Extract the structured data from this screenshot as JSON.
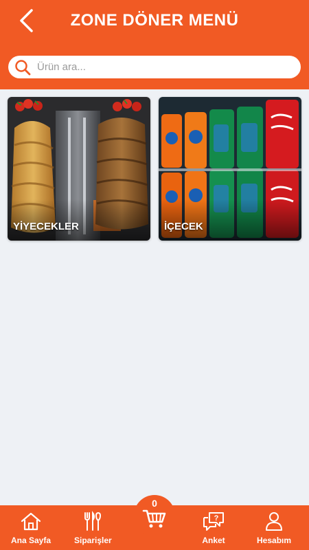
{
  "header": {
    "title": "ZONE DÖNER MENÜ",
    "back_icon": "chevron-left-icon",
    "bg_color": "#f15a24"
  },
  "search": {
    "placeholder": "Ürün ara...",
    "value": "",
    "icon": "search-icon"
  },
  "categories": [
    {
      "label": "YİYECEKLER",
      "image": "doner-kebab-photo"
    },
    {
      "label": "İÇECEK",
      "image": "soda-cans-photo"
    }
  ],
  "cart": {
    "count": "0",
    "icon": "cart-icon"
  },
  "bottom_nav": [
    {
      "label": "Ana Sayfa",
      "icon": "home-icon"
    },
    {
      "label": "Siparişler",
      "icon": "cutlery-icon"
    },
    {
      "label": "Anket",
      "icon": "survey-chat-icon"
    },
    {
      "label": "Hesabım",
      "icon": "user-icon"
    }
  ],
  "colors": {
    "accent": "#f15a24",
    "background": "#eef1f5"
  }
}
